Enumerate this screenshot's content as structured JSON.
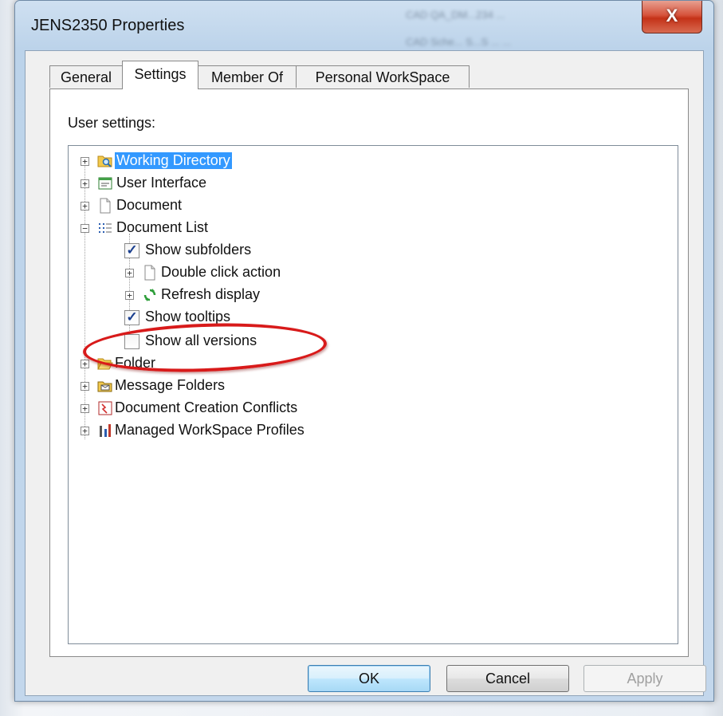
{
  "window": {
    "title": "JENS2350 Properties",
    "close_label": "X",
    "background_text": [
      "CAD QA_DM...234 ...",
      "CAD Sche... S...S ... ..."
    ]
  },
  "tabs": [
    {
      "label": "General",
      "active": false
    },
    {
      "label": "Settings",
      "active": true
    },
    {
      "label": "Member Of",
      "active": false
    },
    {
      "label": "Personal WorkSpace",
      "active": false
    }
  ],
  "settings": {
    "label": "User settings:",
    "tree": [
      {
        "label": "Working Directory",
        "icon": "folder-search-icon",
        "selected": true
      },
      {
        "label": "User Interface",
        "icon": "window-icon"
      },
      {
        "label": "Document",
        "icon": "document-icon"
      },
      {
        "label": "Document List",
        "icon": "list-icon",
        "expanded": true,
        "children": [
          {
            "label": "Show subfolders",
            "type": "checkbox",
            "checked": true
          },
          {
            "label": "Double click action",
            "icon": "document-icon"
          },
          {
            "label": "Refresh display",
            "icon": "refresh-icon"
          },
          {
            "label": "Show tooltips",
            "type": "checkbox",
            "checked": true
          },
          {
            "label": "Show all versions",
            "type": "checkbox",
            "checked": false,
            "highlighted": true
          }
        ]
      },
      {
        "label": "Folder",
        "icon": "open-folder-icon"
      },
      {
        "label": "Message Folders",
        "icon": "message-folder-icon"
      },
      {
        "label": "Document Creation Conflicts",
        "icon": "conflict-icon"
      },
      {
        "label": "Managed WorkSpace Profiles",
        "icon": "tools-icon"
      }
    ]
  },
  "buttons": {
    "ok": "OK",
    "cancel": "Cancel",
    "apply": "Apply"
  },
  "colors": {
    "selection": "#3399ff",
    "highlight_ring": "#d81a1a",
    "close_button": "#c43218"
  }
}
